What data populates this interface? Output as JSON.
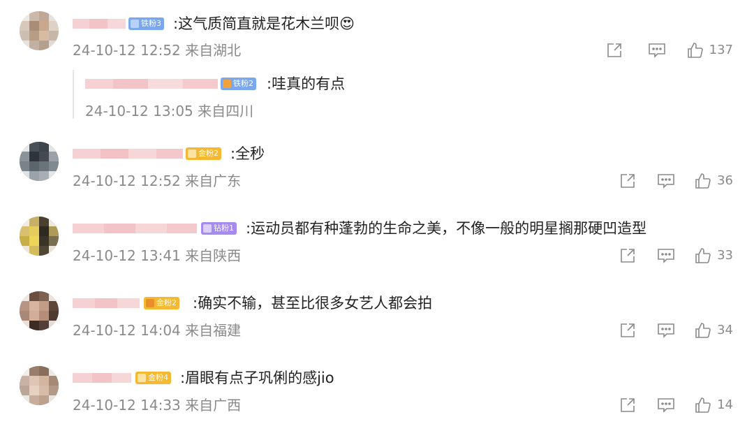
{
  "colors": {
    "text": "#222222",
    "meta": "#8a8a8a",
    "badge_iron": "#7aa7ee",
    "badge_gold": "#f4b832",
    "badge_diamond": "#a58bf0"
  },
  "comments": [
    {
      "badge": "铁粉3",
      "badge_type": "iron",
      "text": ":这气质简直就是花木兰呗",
      "emoji": "😍",
      "time": "24-10-12 12:52",
      "location": "来自湖北",
      "likes": "137",
      "reply": {
        "badge": "铁粉2",
        "badge_type": "iron",
        "text": ":哇真的有点",
        "time": "24-10-12 13:05",
        "location": "来自四川"
      }
    },
    {
      "badge": "金粉2",
      "badge_type": "gold",
      "text": ":全秒",
      "time": "24-10-12 12:52",
      "location": "来自广东",
      "likes": "36"
    },
    {
      "badge": "钻粉1",
      "badge_type": "diamond",
      "text": ":运动员都有种蓬勃的生命之美，不像一般的明星搁那硬凹造型",
      "time": "24-10-12 13:41",
      "location": "来自陕西",
      "likes": "33"
    },
    {
      "badge": "金粉2",
      "badge_type": "gold",
      "text": ":确实不输，甚至比很多女艺人都会拍",
      "time": "24-10-12 14:04",
      "location": "来自福建",
      "likes": "34"
    },
    {
      "badge": "金粉4",
      "badge_type": "gold",
      "text": ":眉眼有点子巩俐的感jio",
      "time": "24-10-12 14:33",
      "location": "来自广西",
      "likes": "14"
    }
  ],
  "icons": {
    "share": "share-icon",
    "comment": "comment-icon",
    "like": "like-icon"
  }
}
